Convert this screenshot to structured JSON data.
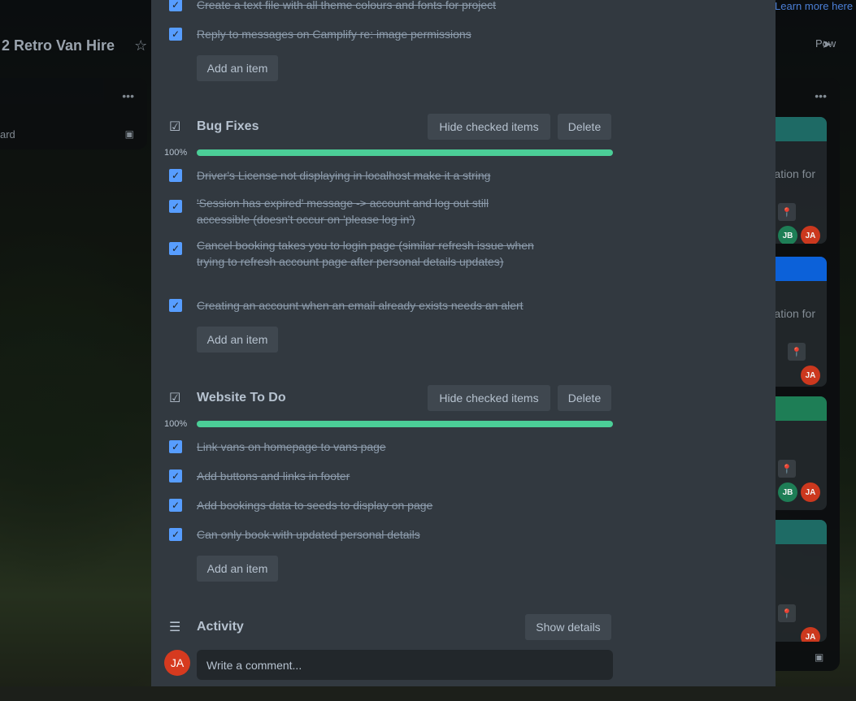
{
  "board": {
    "title": "2 Retro Van Hire",
    "learn_more": "Learn more here",
    "power_ups_label": "Pow"
  },
  "left_list": {
    "card_text": "ard"
  },
  "right_list": {
    "cards": [
      {
        "text": "ation for",
        "stripe_color": "#1f6f6a"
      },
      {
        "text": "ation for",
        "stripe_color": "#0c66e4"
      },
      {
        "text": "",
        "stripe_color": "#1f845a"
      },
      {
        "text": "",
        "stripe_color": "#1f6f6a"
      }
    ],
    "avatars": [
      "JB",
      "JA"
    ]
  },
  "checklists": [
    {
      "title": "Bug Fixes",
      "progress_label": "100%",
      "progress": 1.0,
      "hide_label": "Hide checked items",
      "delete_label": "Delete",
      "items": [
        "Driver's License not displaying in localhost make it a string",
        "'Session has expired' message -> account and log out still accessible (doesn't occur on 'please log in')",
        "Cancel booking takes you to login page (similar refresh issue when trying to refresh account page after personal details updates)",
        "Creating an account when an email already exists needs an alert"
      ],
      "add_label": "Add an item"
    },
    {
      "title": "Website To Do",
      "progress_label": "100%",
      "progress": 1.0,
      "hide_label": "Hide checked items",
      "delete_label": "Delete",
      "items": [
        "Link vans on homepage to vans page",
        "Add buttons and links in footer",
        "Add bookings data to seeds to display on page",
        "Can only book with updated personal details"
      ],
      "add_label": "Add an item"
    }
  ],
  "previous_checklist": {
    "items": [
      "Create a text file with all theme colours and fonts for project",
      "Reply to messages on Camplify re: image permissions"
    ],
    "add_label": "Add an item"
  },
  "activity": {
    "title": "Activity",
    "show_details_label": "Show details",
    "avatar_initials": "JA",
    "comment_placeholder": "Write a comment..."
  },
  "colors": {
    "checkbox": "#579dff",
    "progress": "#4bce97",
    "modal_bg": "#323940",
    "avatar_ja": "#d63a1f",
    "avatar_jb": "#1f845a"
  }
}
